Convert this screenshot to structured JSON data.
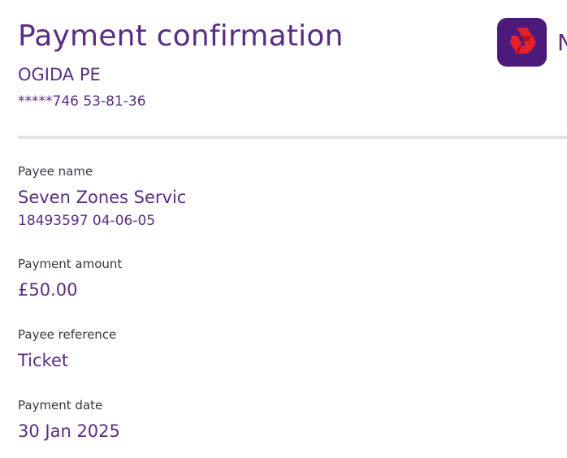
{
  "header": {
    "title": "Payment confirmation",
    "account_name": "OGIDA PE",
    "account_number": "*****746 53-81-36",
    "brand_letter": "N",
    "logo_icon": "natwest-logo-icon"
  },
  "details": {
    "payee_name_label": "Payee name",
    "payee_name": "Seven Zones Servic",
    "payee_account": "18493597 04-06-05",
    "amount_label": "Payment amount",
    "amount": "£50.00",
    "reference_label": "Payee reference",
    "reference": "Ticket",
    "date_label": "Payment date",
    "date": "30 Jan 2025"
  },
  "colors": {
    "brand_purple": "#5a2d82",
    "logo_background": "#4b1a7a",
    "logo_red": "#e8202a",
    "divider": "#e3e3e6"
  }
}
